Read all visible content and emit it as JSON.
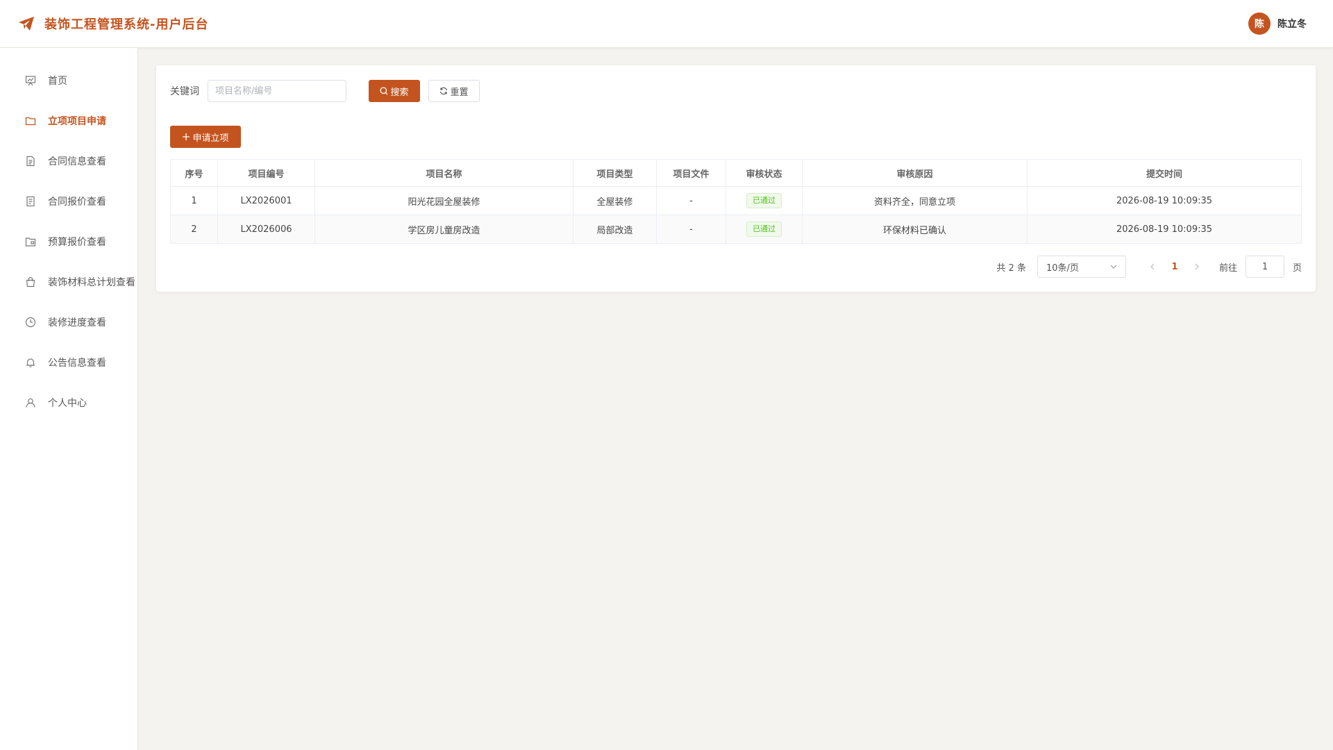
{
  "header": {
    "title": "装饰工程管理系统-用户后台",
    "logo_icon": "paper-plane-icon",
    "avatar_text": "陈",
    "user_name": "陈立冬"
  },
  "colors": {
    "accent": "#c4541f",
    "success": "#52c41a"
  },
  "sidebar": {
    "items": [
      {
        "label": "首页",
        "icon": "dashboard-icon"
      },
      {
        "label": "立项项目申请",
        "icon": "folder-icon",
        "active": true
      },
      {
        "label": "合同信息查看",
        "icon": "document-icon"
      },
      {
        "label": "合同报价查看",
        "icon": "document-list-icon"
      },
      {
        "label": "预算报价查看",
        "icon": "folder-box-icon"
      },
      {
        "label": "装饰材料总计划查看",
        "icon": "shopping-bag-icon"
      },
      {
        "label": "装修进度查看",
        "icon": "clock-icon"
      },
      {
        "label": "公告信息查看",
        "icon": "bell-icon"
      },
      {
        "label": "个人中心",
        "icon": "user-icon"
      }
    ]
  },
  "search": {
    "keyword_label": "关键词",
    "placeholder": "项目名称/编号",
    "value": "",
    "search_label": "搜索",
    "reset_label": "重置"
  },
  "toolbar": {
    "add_label": "申请立项"
  },
  "table": {
    "headers": [
      "序号",
      "项目编号",
      "项目名称",
      "项目类型",
      "项目文件",
      "审核状态",
      "审核原因",
      "提交时间"
    ],
    "rows": [
      {
        "index": "1",
        "code": "LX2026001",
        "name": "阳光花园全屋装修",
        "type": "全屋装修",
        "file": "-",
        "status": "已通过",
        "reason": "资料齐全，同意立项",
        "time": "2026-08-19 10:09:35"
      },
      {
        "index": "2",
        "code": "LX2026006",
        "name": "学区房儿童房改造",
        "type": "局部改造",
        "file": "-",
        "status": "已通过",
        "reason": "环保材料已确认",
        "time": "2026-08-19 10:09:35"
      }
    ]
  },
  "pagination": {
    "total_text": "共 2 条",
    "page_size": "10条/页",
    "current_page": "1",
    "goto_label": "前往",
    "goto_value": "1",
    "page_suffix": "页"
  }
}
